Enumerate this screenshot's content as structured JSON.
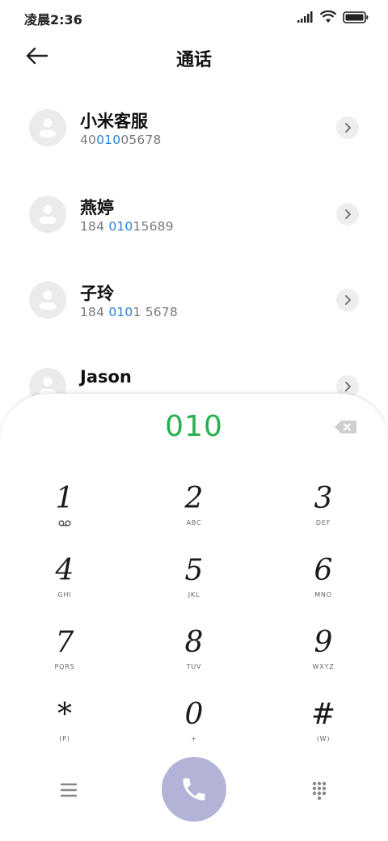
{
  "status_bar": {
    "time": "凌晨2:36",
    "icons": [
      "signal-icon",
      "wifi-icon",
      "battery-icon"
    ]
  },
  "header": {
    "title": "通话",
    "back_icon": "arrow-left-icon"
  },
  "contacts": [
    {
      "name": "小米客服",
      "number_parts": [
        "40",
        "010",
        "05678"
      ]
    },
    {
      "name": "燕婷",
      "number_parts": [
        "184 ",
        "010",
        "15689"
      ]
    },
    {
      "name": "子玲",
      "number_parts": [
        "184 ",
        "010",
        "1 5678"
      ]
    },
    {
      "name": "Jason",
      "number_parts": [
        "",
        "",
        ""
      ]
    }
  ],
  "dialpad": {
    "input_value": "010",
    "input_color": "#27b04f",
    "highlight_color": "#2a83d6",
    "keys": [
      {
        "digit": "1",
        "sub": "voicemail-icon"
      },
      {
        "digit": "2",
        "sub": "ABC"
      },
      {
        "digit": "3",
        "sub": "DEF"
      },
      {
        "digit": "4",
        "sub": "GHI"
      },
      {
        "digit": "5",
        "sub": "JKL"
      },
      {
        "digit": "6",
        "sub": "MNO"
      },
      {
        "digit": "7",
        "sub": "PQRS"
      },
      {
        "digit": "8",
        "sub": "TUV"
      },
      {
        "digit": "9",
        "sub": "WXYZ"
      },
      {
        "digit": "*",
        "sub": "(P)"
      },
      {
        "digit": "0",
        "sub": "+"
      },
      {
        "digit": "#",
        "sub": "(W)"
      }
    ],
    "call_button_color": "#b3b3d8",
    "bottom_icons": [
      "menu-icon",
      "phone-icon",
      "keypad-icon"
    ]
  }
}
